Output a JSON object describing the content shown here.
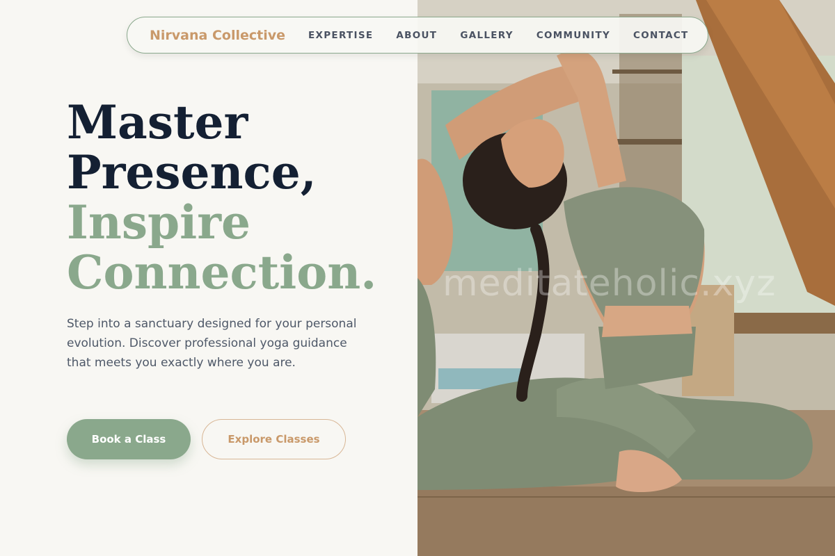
{
  "nav": {
    "brand": "Nirvana Collective",
    "links": [
      "EXPERTISE",
      "ABOUT",
      "GALLERY",
      "COMMUNITY",
      "CONTACT"
    ]
  },
  "hero": {
    "headline_line1": "Master",
    "headline_line2": "Presence,",
    "headline_line3": "Inspire",
    "headline_line4": "Connection.",
    "intro": "Step into a sanctuary designed for your personal evolution. Discover professional yoga guidance that meets you exactly where you are.",
    "primary_button": "Book a Class",
    "secondary_button": "Explore Classes"
  },
  "image": {
    "alt": "Woman in sage green athletic wear doing a seated back-bend yoga pose indoors",
    "watermark": "meditateholic.xyz"
  },
  "colors": {
    "accent_green": "#8aa88c",
    "accent_tan": "#c9996a",
    "heading_dark": "#142033",
    "body_text": "#4e5868",
    "background": "#f8f7f3"
  }
}
